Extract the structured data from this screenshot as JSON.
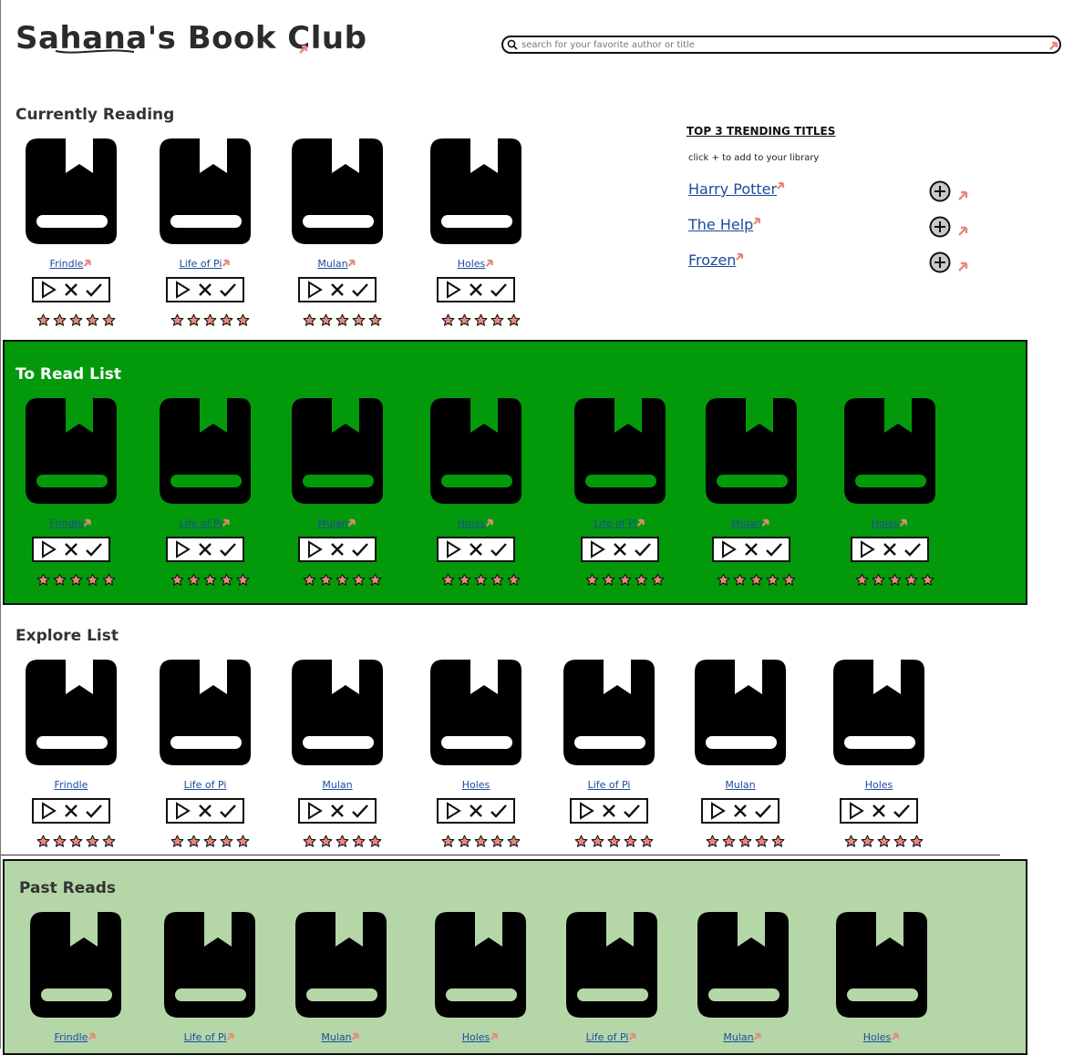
{
  "header": {
    "title": "Sahana's Book Club",
    "search_placeholder": "search for your favorite author or title"
  },
  "sections": [
    {
      "id": "currently-reading",
      "title": "Currently Reading",
      "books": [
        "Frindle",
        "Life of Pi",
        "Mulan",
        "Holes"
      ]
    },
    {
      "id": "to-read-list",
      "title": "To Read List",
      "books": [
        "Frindle",
        "Life of Pi",
        "Mulan",
        "Holes",
        "Life of Pi",
        "Mulan",
        "Holes"
      ]
    },
    {
      "id": "explore-list",
      "title": "Explore List",
      "books": [
        "Frindle",
        "Life of Pi",
        "Mulan",
        "Holes",
        "Life of Pi",
        "Mulan",
        "Holes"
      ]
    },
    {
      "id": "past-reads",
      "title": "Past Reads",
      "books": [
        "Frindle",
        "Life of Pi",
        "Mulan",
        "Holes",
        "Life of Pi",
        "Mulan",
        "Holes"
      ]
    }
  ],
  "trending": {
    "title": "TOP 3 TRENDING TITLES",
    "hint": "click + to add to your library",
    "items": [
      "Harry Potter",
      "The Help",
      "Frozen"
    ]
  },
  "rating": {
    "max_stars": 5
  },
  "icons": {
    "book": "book-bookmark-icon",
    "play": "play-icon",
    "remove": "x-icon",
    "done": "check-icon",
    "star": "star-icon",
    "add": "plus-circle-icon",
    "search": "search-icon"
  },
  "colors": {
    "to_read_band": "#029a0b",
    "past_reads_band": "#b5d7a8",
    "link": "#1c4a9e",
    "star_fill": "#e8897a",
    "annotation_pin": "#e8897a"
  }
}
